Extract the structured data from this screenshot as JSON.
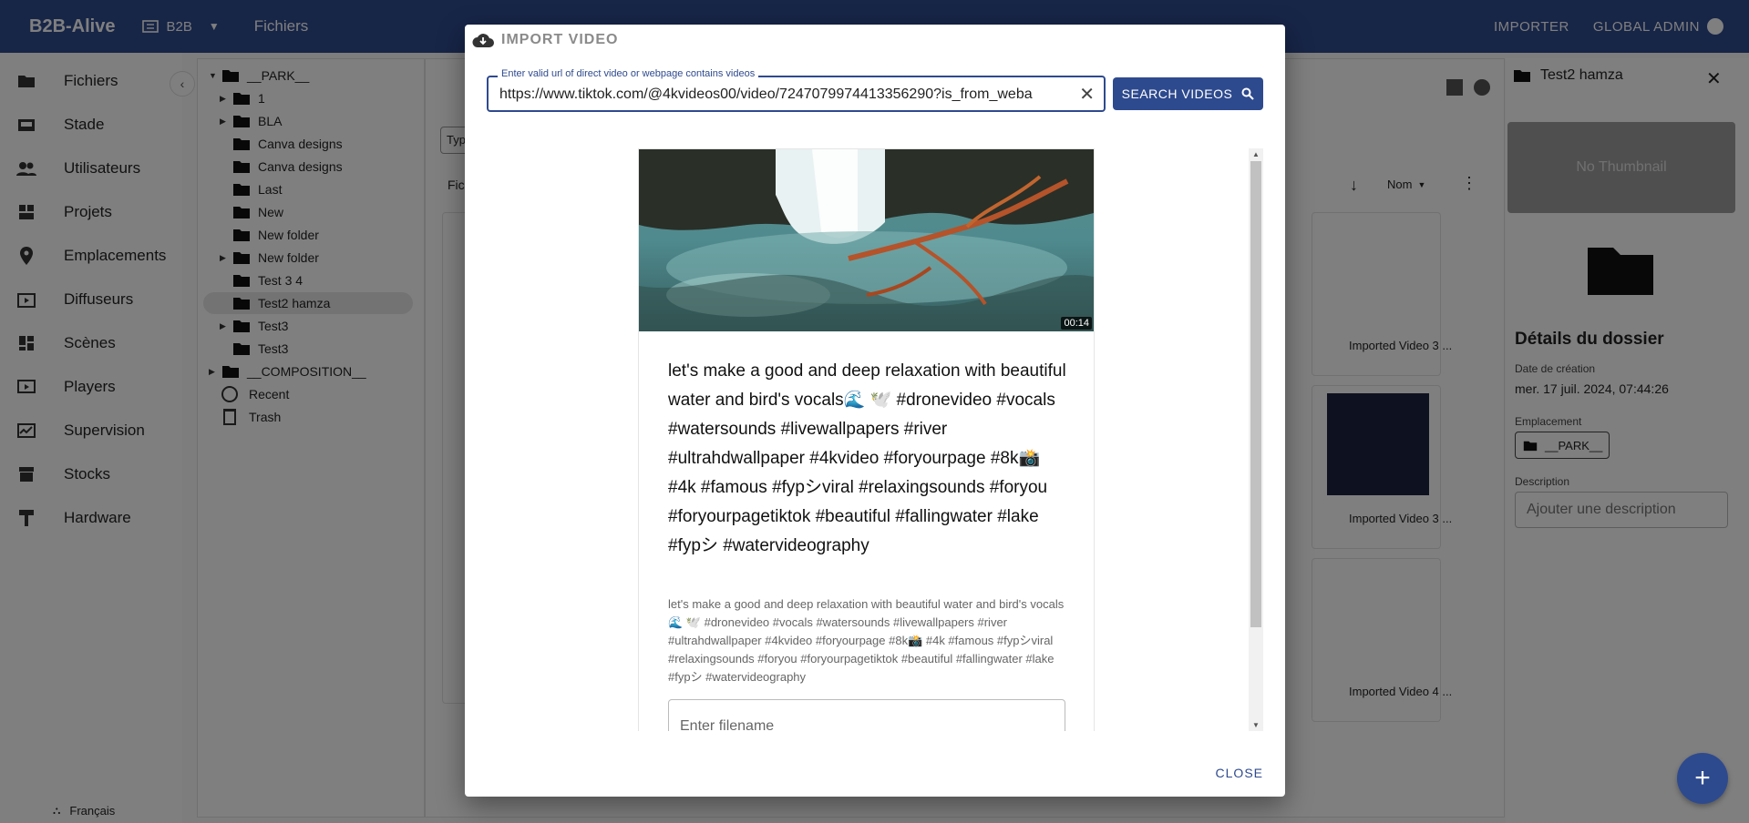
{
  "app": {
    "brand": "B2B-Alive",
    "workspace": "B2B",
    "breadcrumb": "Fichiers",
    "actions": [
      "IMPORTER",
      "GLOBAL ADMIN"
    ]
  },
  "colors": {
    "primary": "#2e4a8e"
  },
  "sidebar": {
    "items": [
      {
        "label": "Fichiers",
        "icon": "folder-icon"
      },
      {
        "label": "Stade",
        "icon": "stadium-icon"
      },
      {
        "label": "Utilisateurs",
        "icon": "users-icon"
      },
      {
        "label": "Projets",
        "icon": "projects-icon"
      },
      {
        "label": "Emplacements",
        "icon": "location-pin-icon"
      },
      {
        "label": "Diffuseurs",
        "icon": "broadcast-icon"
      },
      {
        "label": "Scènes",
        "icon": "dashboard-icon"
      },
      {
        "label": "Players",
        "icon": "player-icon"
      },
      {
        "label": "Supervision",
        "icon": "monitor-icon"
      },
      {
        "label": "Stocks",
        "icon": "archive-icon"
      },
      {
        "label": "Hardware",
        "icon": "hardware-icon"
      }
    ],
    "language": "Français"
  },
  "tree": {
    "items": [
      {
        "label": "__PARK__"
      },
      {
        "label": "1"
      },
      {
        "label": "BLA"
      },
      {
        "label": "Canva designs"
      },
      {
        "label": "Canva designs"
      },
      {
        "label": "Last"
      },
      {
        "label": "New"
      },
      {
        "label": "New folder"
      },
      {
        "label": "New folder"
      },
      {
        "label": "Test 3 4"
      },
      {
        "label": "Test2 hamza"
      },
      {
        "label": "Test3"
      },
      {
        "label": "Test3"
      },
      {
        "label": "__COMPOSITION__"
      },
      {
        "label": "Recent"
      },
      {
        "label": "Trash"
      }
    ]
  },
  "center": {
    "sort_label": "Nom",
    "type_chip": "Typ",
    "files_label": "Fic",
    "cards": [
      "Imported Video 3 ...",
      "Imported Video 3 ...",
      "Imported Video 4 ..."
    ]
  },
  "right_panel": {
    "title": "Test2 hamza",
    "no_thumbnail": "No Thumbnail",
    "details_title": "Détails du dossier",
    "created_label": "Date de création",
    "created_value": "mer. 17 juil. 2024, 07:44:26",
    "location_label": "Emplacement",
    "location_value": "__PARK__",
    "description_label": "Description",
    "description_placeholder": "Ajouter une description"
  },
  "dialog": {
    "title": "IMPORT VIDEO",
    "url_label": "Enter valid url of direct video or webpage contains videos",
    "url_value": "https://www.tiktok.com/@4kvideos00/video/7247079974413356290?is_from_weba",
    "search_label": "SEARCH VIDEOS",
    "video": {
      "duration": "00:14",
      "title": "let's make a good and deep relaxation with beautiful water and bird's vocals🌊 🕊️ #dronevideo #vocals #watersounds #livewallpapers #river #ultrahdwallpaper #4kvideo #foryourpage #8k📸 #4k #famous #fypシviral #relaxingsounds #foryou #foryourpagetiktok #beautiful #fallingwater #lake #fypシ #watervideography",
      "description": "let's make a good and deep relaxation with beautiful water and bird's vocals🌊 🕊️ #dronevideo #vocals #watersounds #livewallpapers #river #ultrahdwallpaper #4kvideo #foryourpage #8k📸 #4k #famous #fypシviral #relaxingsounds #foryou #foryourpagetiktok #beautiful #fallingwater #lake #fypシ #watervideography",
      "filename_placeholder": "Enter filename"
    },
    "close_label": "CLOSE"
  }
}
